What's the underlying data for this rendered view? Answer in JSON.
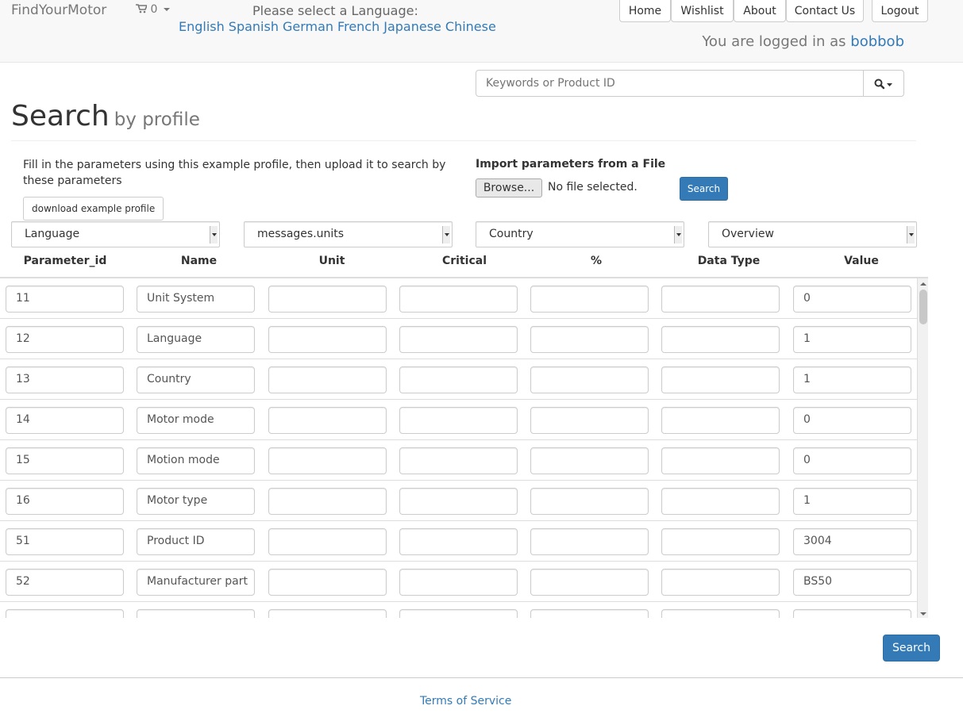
{
  "navbar": {
    "brand": "FindYourMotor",
    "cart_count": "0",
    "language_prompt": "Please select a Language:",
    "languages": [
      "English",
      "Spanish",
      "German",
      "French",
      "Japanese",
      "Chinese"
    ],
    "nav": [
      "Home",
      "Wishlist",
      "About",
      "Contact Us"
    ],
    "logout": "Logout",
    "logged_in_prefix": "You are logged in as ",
    "username": "bobbob"
  },
  "search": {
    "placeholder": "Keywords or Product ID"
  },
  "page": {
    "title": "Search",
    "subtitle": "by profile",
    "fill_text": "Fill in the parameters using this example profile, then upload it to search by these parameters",
    "download_label": "download example profile",
    "import_label": "Import parameters from a File",
    "browse_label": "Browse...",
    "no_file_label": "No file selected.",
    "search_small_label": "Search",
    "search_label": "Search"
  },
  "selects": [
    "Language",
    "messages.units",
    "Country",
    "Overview"
  ],
  "table": {
    "headers": [
      "Parameter_id",
      "Name",
      "Unit",
      "Critical",
      "%",
      "Data Type",
      "Value"
    ],
    "rows": [
      [
        "11",
        "Unit System",
        "",
        "",
        "",
        "",
        "0"
      ],
      [
        "12",
        "Language",
        "",
        "",
        "",
        "",
        "1"
      ],
      [
        "13",
        "Country",
        "",
        "",
        "",
        "",
        "1"
      ],
      [
        "14",
        "Motor mode",
        "",
        "",
        "",
        "",
        "0"
      ],
      [
        "15",
        "Motion mode",
        "",
        "",
        "",
        "",
        "0"
      ],
      [
        "16",
        "Motor type",
        "",
        "",
        "",
        "",
        "1"
      ],
      [
        "51",
        "Product ID",
        "",
        "",
        "",
        "",
        "3004"
      ],
      [
        "52",
        "Manufacturer part",
        "",
        "",
        "",
        "",
        "BS50"
      ]
    ]
  },
  "footer": {
    "terms": "Terms of Service"
  },
  "colors": {
    "primary": "#337ab7",
    "navbar_bg": "#f8f8f8",
    "link": "#337ab7"
  }
}
